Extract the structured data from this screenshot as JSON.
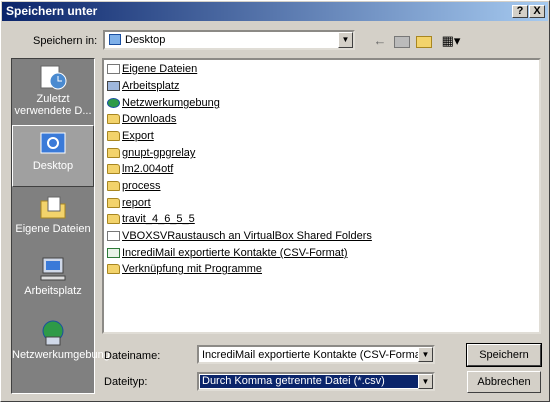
{
  "window": {
    "title": "Speichern unter",
    "help_label": "?",
    "close_label": "X"
  },
  "location": {
    "label": "Speichern in:",
    "value": "Desktop"
  },
  "toolbar": {
    "icons": [
      "back-icon",
      "up-folder-icon",
      "new-folder-icon",
      "view-menu-icon"
    ]
  },
  "places": [
    {
      "label": "Zuletzt verwendete D...",
      "icon": "recent-docs-icon"
    },
    {
      "label": "Desktop",
      "icon": "desktop-icon"
    },
    {
      "label": "Eigene Dateien",
      "icon": "my-documents-icon"
    },
    {
      "label": "Arbeitsplatz",
      "icon": "my-computer-icon"
    },
    {
      "label": "Netzwerkumgebung",
      "icon": "network-icon"
    }
  ],
  "files": [
    {
      "name": "Eigene Dateien",
      "icon": "my-documents-icon"
    },
    {
      "name": "Arbeitsplatz",
      "icon": "my-computer-icon"
    },
    {
      "name": "Netzwerkumgebung",
      "icon": "network-icon"
    },
    {
      "name": "Downloads",
      "icon": "folder-icon"
    },
    {
      "name": "Export",
      "icon": "folder-icon"
    },
    {
      "name": "gnupt-gpgrelay",
      "icon": "folder-icon"
    },
    {
      "name": "lm2.004otf",
      "icon": "folder-icon"
    },
    {
      "name": "process",
      "icon": "folder-icon"
    },
    {
      "name": "report",
      "icon": "folder-icon"
    },
    {
      "name": "travit_4_6_5_5",
      "icon": "folder-icon"
    },
    {
      "name": "VBOXSVRaustausch an VirtualBox Shared Folders",
      "icon": "shortcut-icon"
    },
    {
      "name": "IncrediMail exportierte Kontakte (CSV-Format)",
      "icon": "csv-file-icon"
    },
    {
      "name": "Verknüpfung mit Programme",
      "icon": "shortcut-folder-icon"
    }
  ],
  "filename": {
    "label": "Dateiname:",
    "value": "IncrediMail exportierte Kontakte (CSV-Format)"
  },
  "filetype": {
    "label": "Dateityp:",
    "value": "Durch Komma getrennte Datei (*.csv)"
  },
  "buttons": {
    "save": "Speichern",
    "cancel": "Abbrechen"
  },
  "colors": {
    "titlebar_start": "#0a246a",
    "titlebar_end": "#a6caf0",
    "selection": "#0a246a",
    "dialog_bg": "#d4d0c8"
  }
}
